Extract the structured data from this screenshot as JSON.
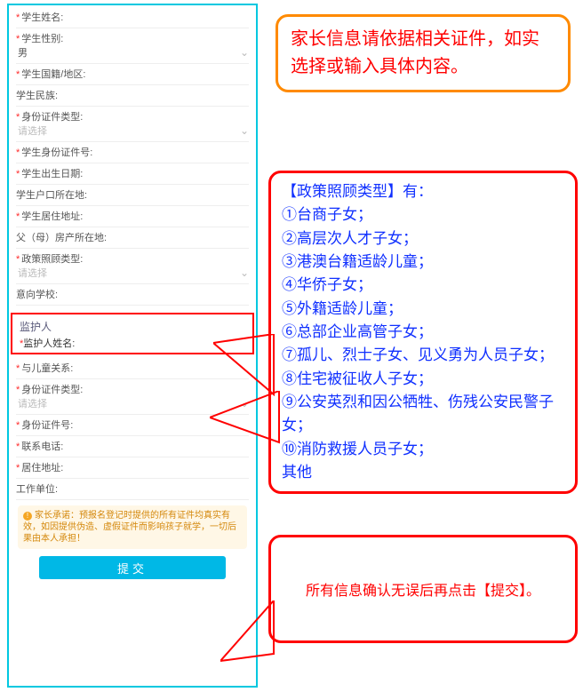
{
  "form": {
    "student_name_label": "学生姓名:",
    "student_gender_label": "学生性别:",
    "student_gender_value": "男",
    "student_nationality_label": "学生国籍/地区:",
    "student_ethnicity_label": "学生民族:",
    "id_type_label": "身份证件类型:",
    "id_type_placeholder": "请选择",
    "id_number_label": "学生身份证件号:",
    "birth_date_label": "学生出生日期:",
    "hukou_label": "学生户口所在地:",
    "residence_label": "学生居住地址:",
    "parent_property_label": "父（母）房产所在地:",
    "policy_type_label": "政策照顾类型:",
    "policy_type_placeholder": "请选择",
    "intent_school_label": "意向学校:",
    "guardian_section": "监护人",
    "guardian_name_label": "监护人姓名:",
    "relation_label": "与儿童关系:",
    "g_id_type_label": "身份证件类型:",
    "g_id_type_placeholder": "请选择",
    "g_id_number_label": "身份证件号:",
    "g_phone_label": "联系电话:",
    "g_address_label": "居住地址:",
    "g_work_label": "工作单位:",
    "pledge_text": "家长承诺：预报名登记时提供的所有证件均真实有效，如因提供伪造、虚假证件而影响孩子就学，一切后果由本人承担！",
    "submit_label": "提交"
  },
  "required_mark": "*",
  "callouts": {
    "orange": "家长信息请依据相关证件，如实选择或输入具体内容。",
    "blue_title": "【政策照顾类型】有：",
    "blue_items": [
      "①台商子女；",
      "②高层次人才子女；",
      "③港澳台籍适龄儿童；",
      "④华侨子女；",
      "⑤外籍适龄儿童；",
      "⑥总部企业高管子女；",
      "⑦孤儿、烈士子女、见义勇为人员子女；",
      "⑧住宅被征收人子女；",
      "⑨公安英烈和因公牺牲、伤残公安民警子女；",
      "⑩消防救援人员子女；",
      "其他"
    ],
    "red": "所有信息确认无误后再点击【提交】。"
  }
}
